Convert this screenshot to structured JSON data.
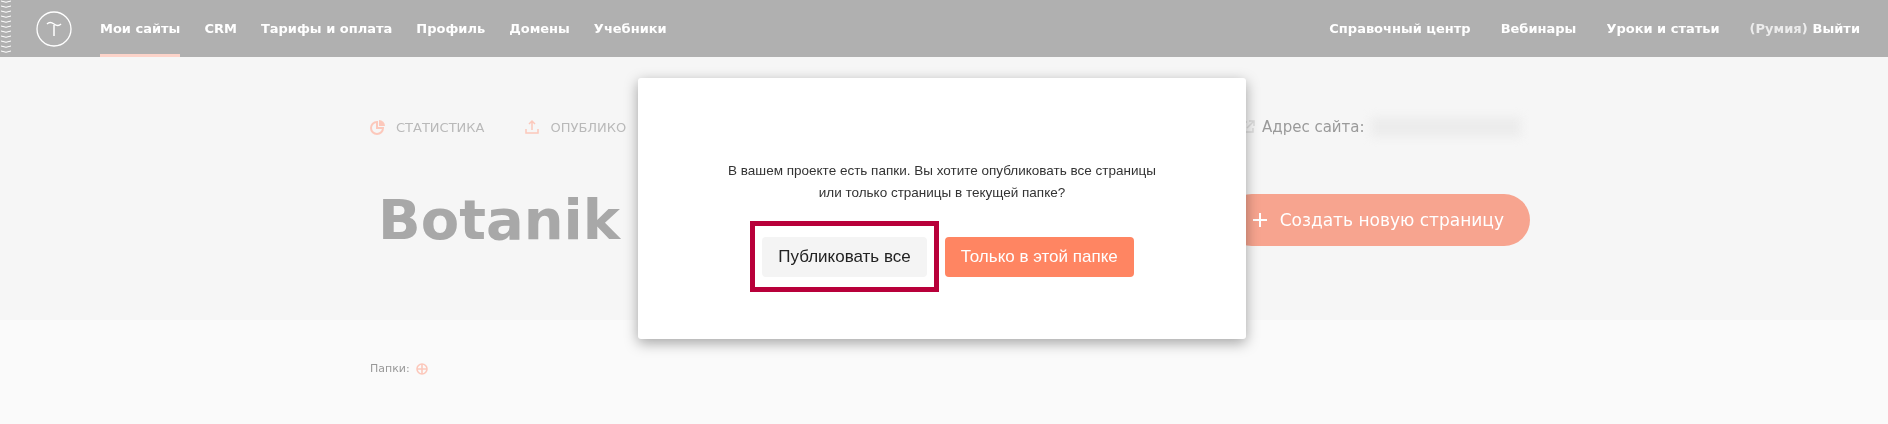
{
  "nav": {
    "items": [
      {
        "label": "Мои сайты",
        "selected": true
      },
      {
        "label": "CRM",
        "selected": false
      },
      {
        "label": "Тарифы и оплата",
        "selected": false
      },
      {
        "label": "Профиль",
        "selected": false
      },
      {
        "label": "Домены",
        "selected": false
      },
      {
        "label": "Учебники",
        "selected": false
      }
    ],
    "right_items": [
      "Справочный центр",
      "Вебинары",
      "Уроки и статьи"
    ],
    "user": "(Румия)",
    "logout": "Выйти"
  },
  "project": {
    "actions": [
      "СТАТИСТИКА",
      "ОПУБЛИКО"
    ],
    "address_label": "Адрес сайта:",
    "title": "Botanik",
    "create_button": "Создать новую страницу",
    "folders_label": "Папки:"
  },
  "modal": {
    "message": "В вашем проекте есть папки. Вы хотите опубликовать все страницы или только страницы в текущей папке?",
    "buttons": [
      {
        "label": "Публиковать все",
        "kind": "secondary",
        "highlighted": true
      },
      {
        "label": "Только в этой папке",
        "kind": "primary",
        "highlighted": false
      }
    ]
  }
}
